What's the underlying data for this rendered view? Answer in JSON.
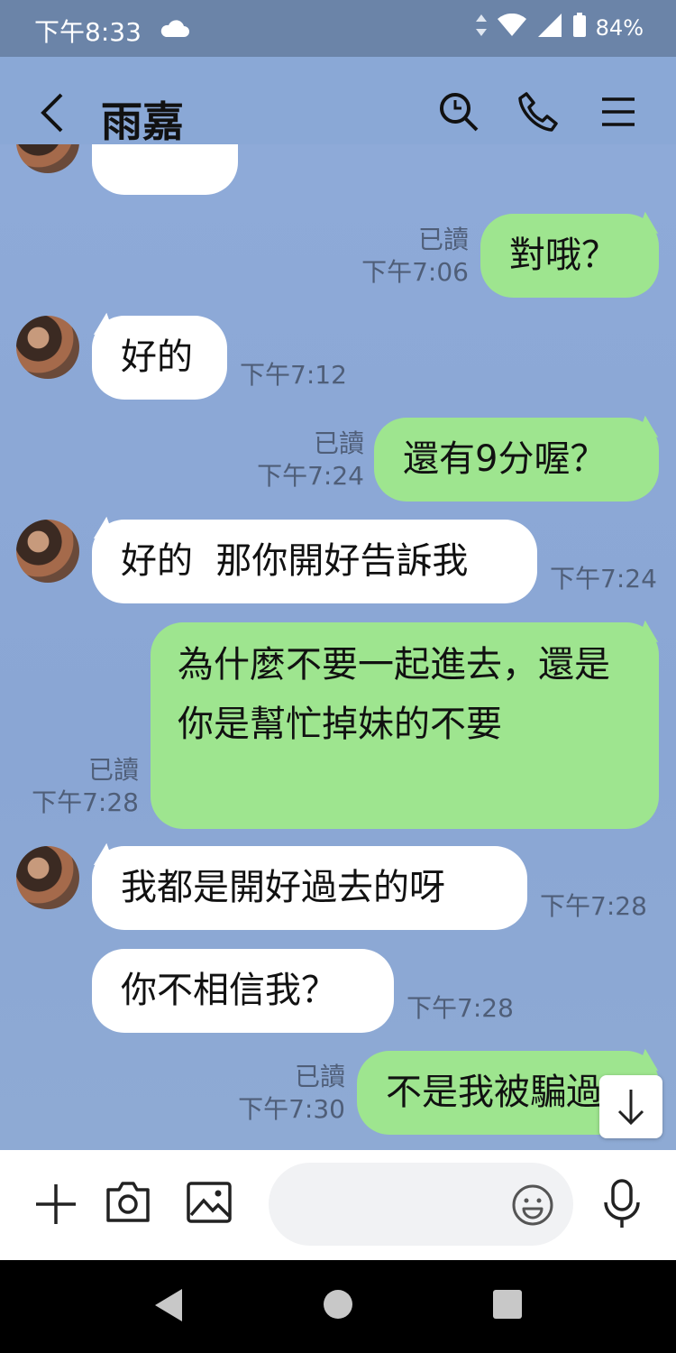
{
  "status_bar": {
    "time": "下午8:33",
    "battery": "84%"
  },
  "header": {
    "contact_name": "雨嘉"
  },
  "messages": [
    {
      "text": "對哦？",
      "read": "已讀",
      "time": "下午7:06"
    },
    {
      "text": "好的",
      "time": "下午7:12"
    },
    {
      "text": "還有9分喔？",
      "read": "已讀",
      "time": "下午7:24"
    },
    {
      "text": "好的  那你開好告訴我",
      "time": "下午7:24"
    },
    {
      "text": "為什麼不要一起進去，還是你是幫忙掉妹的不要",
      "read": "已讀",
      "time": "下午7:28"
    },
    {
      "text": "我都是開好過去的呀",
      "time": "下午7:28"
    },
    {
      "text": "你不相信我？",
      "time": "下午7:28"
    },
    {
      "text": "不是我被騙過",
      "read": "已讀",
      "time": "下午7:30"
    }
  ],
  "colors": {
    "chat_bg": "#8aa8d6",
    "outgoing": "#9ee58f",
    "incoming": "#ffffff",
    "status_bar": "#6b84a8"
  }
}
